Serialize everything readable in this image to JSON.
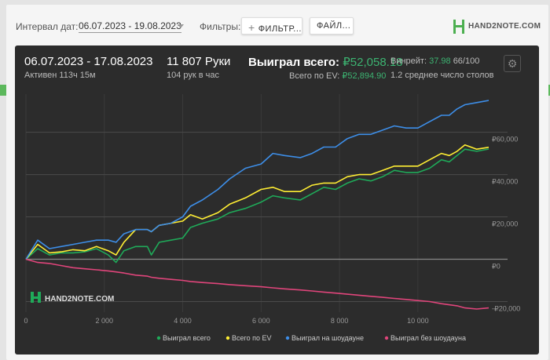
{
  "topbar": {
    "date_label": "Интервал дат:",
    "date_value": "06.07.2023 - 19.08.2023",
    "filters_label": "Фильтры:",
    "filter_button": "ФИЛЬТР...",
    "files_button": "ФАЙЛ...",
    "brand": "HAND2NOTE.COM"
  },
  "stats": {
    "range": "06.07.2023 - 17.08.2023",
    "active": "Активен 113ч 15м",
    "hands": "11 807 Руки",
    "hands_rate": "104 рук в час",
    "won_label": "Выиграл всего:",
    "won_value": "₽52,058.18",
    "ev_label": "Всего по EV:",
    "ev_value": "₽52,894.90",
    "winrate_label": "Винрейт:",
    "winrate_value": "37.98",
    "winrate_suffix": "66/100",
    "tables": "1.2 среднее число столов"
  },
  "colors": {
    "won": "#1faa59",
    "ev": "#ffee33",
    "showdown": "#3d8ee8",
    "no_showdown": "#e0457b"
  },
  "chart_data": {
    "type": "line",
    "xlabel": "",
    "ylabel": "",
    "xlim": [
      0,
      11807
    ],
    "ylim": [
      -25000,
      78000
    ],
    "x_ticks": [
      0,
      2000,
      4000,
      6000,
      8000,
      10000
    ],
    "x_tick_labels": [
      "0",
      "2 000",
      "4 000",
      "6 000",
      "8 000",
      "10 000"
    ],
    "y_ticks": [
      60000,
      40000,
      20000,
      0,
      -20000
    ],
    "y_tick_labels": [
      "₽60,000",
      "₽40,000",
      "₽20,000",
      "₽0",
      "-₽20,000"
    ],
    "grid": true,
    "watermark": "HAND2NOTE.COM",
    "legend_position": "bottom-right",
    "series": [
      {
        "name": "Выиграл всего",
        "color": "#1faa59",
        "x": [
          0,
          300,
          600,
          900,
          1200,
          1500,
          1800,
          2100,
          2300,
          2500,
          2800,
          3100,
          3200,
          3400,
          3700,
          4000,
          4200,
          4500,
          4900,
          5200,
          5600,
          6000,
          6300,
          6600,
          7000,
          7300,
          7600,
          7900,
          8200,
          8500,
          8800,
          9100,
          9400,
          9700,
          10000,
          10300,
          10600,
          10800,
          11000,
          11200,
          11500,
          11807
        ],
        "y": [
          0,
          5000,
          2000,
          3000,
          3000,
          3500,
          5000,
          2000,
          -1500,
          4000,
          6000,
          6000,
          2000,
          8000,
          9000,
          10000,
          15000,
          17000,
          19000,
          22000,
          24000,
          27000,
          30000,
          29000,
          28000,
          31000,
          34000,
          33000,
          36000,
          38000,
          37000,
          39000,
          42000,
          41000,
          41000,
          43000,
          47000,
          46000,
          49000,
          52000,
          51000,
          52058
        ]
      },
      {
        "name": "Всего по EV",
        "color": "#ffee33",
        "x": [
          0,
          300,
          600,
          900,
          1200,
          1500,
          1800,
          2100,
          2300,
          2500,
          2800,
          3100,
          3200,
          3400,
          3700,
          4000,
          4200,
          4500,
          4900,
          5200,
          5600,
          6000,
          6300,
          6600,
          7000,
          7300,
          7600,
          7900,
          8200,
          8500,
          8800,
          9100,
          9400,
          9700,
          10000,
          10300,
          10600,
          10800,
          11000,
          11200,
          11500,
          11807
        ],
        "y": [
          0,
          7000,
          3000,
          3500,
          4500,
          4000,
          6000,
          4000,
          2000,
          8000,
          14000,
          14000,
          13000,
          16000,
          17000,
          18000,
          21000,
          19000,
          22000,
          26000,
          29000,
          33000,
          34000,
          32000,
          32000,
          35000,
          36000,
          36000,
          39000,
          40000,
          40000,
          42000,
          44000,
          44000,
          44000,
          47000,
          50000,
          49000,
          51000,
          54000,
          52000,
          52895
        ]
      },
      {
        "name": "Выиграл на шоудауне",
        "color": "#3d8ee8",
        "x": [
          0,
          300,
          600,
          900,
          1200,
          1500,
          1800,
          2100,
          2300,
          2500,
          2800,
          3100,
          3200,
          3400,
          3700,
          4000,
          4200,
          4500,
          4900,
          5200,
          5600,
          6000,
          6300,
          6600,
          7000,
          7300,
          7600,
          7900,
          8200,
          8500,
          8800,
          9100,
          9400,
          9700,
          10000,
          10300,
          10600,
          10800,
          11000,
          11200,
          11500,
          11807
        ],
        "y": [
          0,
          9000,
          5000,
          6000,
          7000,
          8000,
          9000,
          9000,
          8000,
          12000,
          14000,
          14000,
          13000,
          16000,
          17000,
          20000,
          25000,
          28000,
          33000,
          38000,
          43000,
          45000,
          50000,
          49000,
          48000,
          50000,
          53000,
          53000,
          57000,
          59000,
          59000,
          61000,
          63000,
          62000,
          62000,
          65000,
          68000,
          68000,
          71000,
          73000,
          74000,
          75000
        ]
      },
      {
        "name": "Выиграл без шоудауна",
        "color": "#e0457b",
        "x": [
          0,
          300,
          600,
          900,
          1200,
          1500,
          1800,
          2100,
          2300,
          2500,
          2800,
          3100,
          3200,
          3400,
          3700,
          4000,
          4200,
          4500,
          4900,
          5200,
          5600,
          6000,
          6300,
          6600,
          7000,
          7300,
          7600,
          7900,
          8200,
          8500,
          8800,
          9100,
          9400,
          9700,
          10000,
          10300,
          10600,
          10800,
          11000,
          11200,
          11500,
          11807
        ],
        "y": [
          0,
          -1500,
          -2000,
          -3000,
          -4000,
          -4500,
          -5000,
          -5500,
          -6000,
          -6500,
          -7500,
          -8000,
          -8500,
          -9000,
          -9500,
          -10000,
          -10500,
          -11000,
          -11500,
          -12000,
          -12500,
          -13000,
          -13500,
          -14000,
          -14500,
          -15000,
          -15500,
          -16000,
          -16500,
          -17000,
          -17500,
          -18000,
          -18500,
          -19000,
          -19500,
          -20000,
          -21000,
          -21500,
          -22000,
          -23000,
          -23500,
          -23000
        ]
      }
    ]
  }
}
